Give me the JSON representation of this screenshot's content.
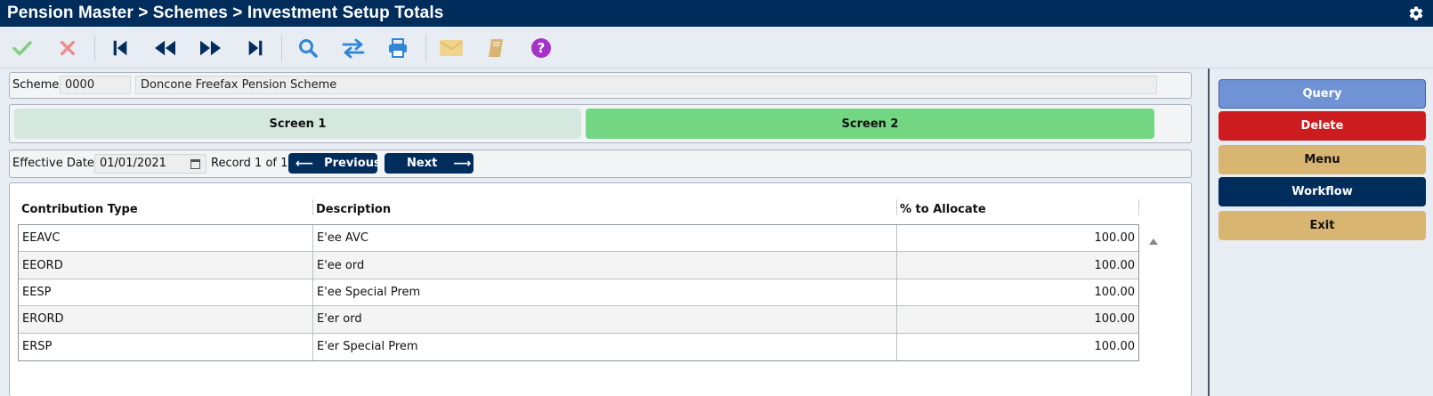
{
  "window": {
    "title": "Pension Master > Schemes > Investment Setup Totals",
    "settings_icon": "gear-icon"
  },
  "toolbar": {
    "items": [
      {
        "name": "confirm-icon",
        "color": "#7fd17f"
      },
      {
        "name": "cancel-icon",
        "color": "#f08a8a"
      },
      {
        "name": "first-record-icon",
        "color": "#012d5c"
      },
      {
        "name": "previous-record-icon",
        "color": "#012d5c"
      },
      {
        "name": "next-record-icon",
        "color": "#012d5c"
      },
      {
        "name": "last-record-icon",
        "color": "#012d5c"
      },
      {
        "name": "search-icon",
        "color": "#2f86d6"
      },
      {
        "name": "swap-icon",
        "color": "#2f86d6"
      },
      {
        "name": "print-icon",
        "color": "#2f86d6"
      },
      {
        "name": "mail-icon",
        "color": "#f0d48e"
      },
      {
        "name": "notebook-icon",
        "color": "#d8b672"
      },
      {
        "name": "help-icon",
        "color": "#a632c9"
      }
    ]
  },
  "scheme": {
    "label": "Scheme",
    "code": "0000",
    "name": "Doncone Freefax Pension Scheme"
  },
  "tabs": [
    {
      "label": "Screen 1",
      "active": false
    },
    {
      "label": "Screen 2",
      "active": true
    }
  ],
  "effective": {
    "label": "Effective Date",
    "date": "01/01/2021",
    "record_text": "Record 1 of 1",
    "previous_label": "Previous",
    "next_label": "Next"
  },
  "grid": {
    "columns": [
      "Contribution Type",
      "Description",
      "% to Allocate"
    ],
    "rows": [
      {
        "type": "EEAVC",
        "description": "E'ee AVC",
        "percent": "100.00"
      },
      {
        "type": "EEORD",
        "description": "E'ee ord",
        "percent": "100.00"
      },
      {
        "type": "EESP",
        "description": "E'ee Special Prem",
        "percent": "100.00"
      },
      {
        "type": "ERORD",
        "description": "E'er ord",
        "percent": "100.00"
      },
      {
        "type": "ERSP",
        "description": "E'er Special Prem",
        "percent": "100.00"
      }
    ]
  },
  "actions": {
    "query": "Query",
    "delete": "Delete",
    "menu": "Menu",
    "workflow": "Workflow",
    "exit": "Exit"
  },
  "colors": {
    "title_bar": "#012d5c",
    "active_tab": "#73d683",
    "inactive_tab": "#d4e8e0",
    "query": "#7093d6",
    "delete": "#cd1c1f",
    "menu_exit": "#d8b672",
    "workflow": "#012d5c"
  }
}
